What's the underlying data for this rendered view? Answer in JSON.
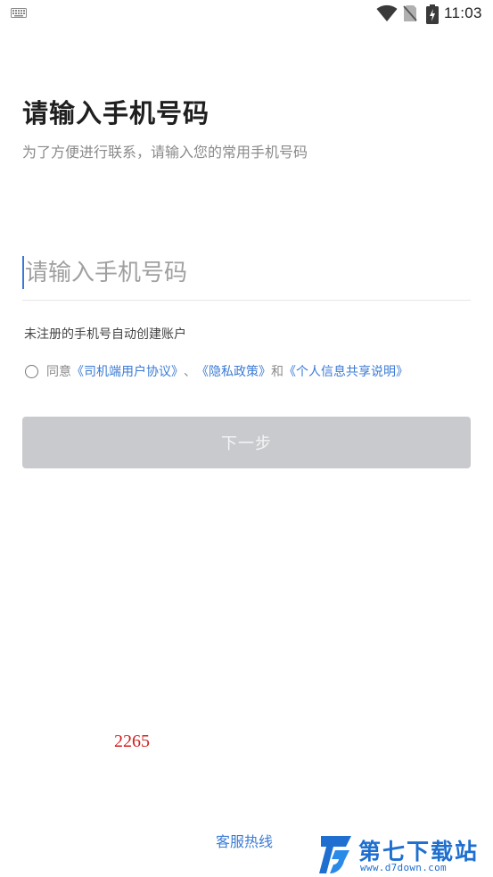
{
  "status_bar": {
    "time": "11:03",
    "icons": [
      "keyboard-icon",
      "wifi-icon",
      "no-sim-icon",
      "battery-charging-icon"
    ]
  },
  "login": {
    "title": "请输入手机号码",
    "subtitle": "为了方便进行联系，请输入您的常用手机号码",
    "phone_placeholder": "请输入手机号码",
    "phone_value": "",
    "auto_register_hint": "未注册的手机号自动创建账户"
  },
  "agreement": {
    "checked": false,
    "prefix": "同意",
    "driver_agreement": "《司机端用户协议》",
    "separator": "、",
    "privacy_policy": "《隐私政策》",
    "conjunction": "和",
    "info_sharing": "《个人信息共享说明》"
  },
  "next_button": {
    "label": "下一步",
    "enabled": false
  },
  "overlay_number": "2265",
  "footer": {
    "service_hotline": "客服热线"
  },
  "watermark": {
    "name": "第七下载站",
    "url": "www.d7down.com"
  },
  "colors": {
    "link": "#3b7bd4",
    "button_disabled": "#c9cacd",
    "caret": "#3a78d8",
    "overlay_number": "#d02020",
    "watermark": "#1e6fd0"
  }
}
